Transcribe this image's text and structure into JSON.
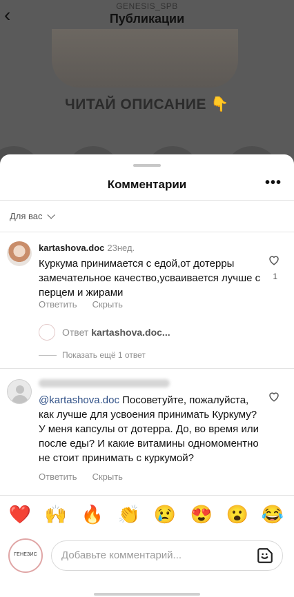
{
  "header": {
    "username": "GENESIS_SPB",
    "title": "Публикации",
    "back_icon": "chevron-left-icon"
  },
  "post": {
    "caption": "ЧИТАЙ ОПИСАНИЕ 👇"
  },
  "sheet": {
    "title": "Комментарии",
    "more": "•••",
    "filter": "Для вас"
  },
  "comments": [
    {
      "username": "kartashova.doc",
      "time": "23нед.",
      "text": "Куркума принимается с едой,от дотерры замечательное качество,усваивается лучше с перцем и жирами",
      "reply_label": "Ответить",
      "hide_label": "Скрыть",
      "likes": "1",
      "reply_preview_prefix": "Ответ",
      "reply_preview_user": "kartashova.doc...",
      "show_more_replies": "Показать ещё 1 ответ"
    },
    {
      "username_blurred": true,
      "mention": "@kartashova.doc",
      "text": " Посоветуйте, пожалуйста, как лучше для усвоения принимать Куркуму? У меня капсулы от дотерра. До, во время или после еды? И какие витамины одномоментно не стоит принимать с куркумой?",
      "reply_label": "Ответить",
      "hide_label": "Скрыть"
    }
  ],
  "emojis": [
    "❤️",
    "🙌",
    "🔥",
    "👏",
    "😢",
    "😍",
    "😮",
    "😂"
  ],
  "composer": {
    "avatar_text": "ГЕНЕЗИС",
    "placeholder": "Добавьте комментарий...",
    "sticker_icon": "sticker-icon"
  }
}
